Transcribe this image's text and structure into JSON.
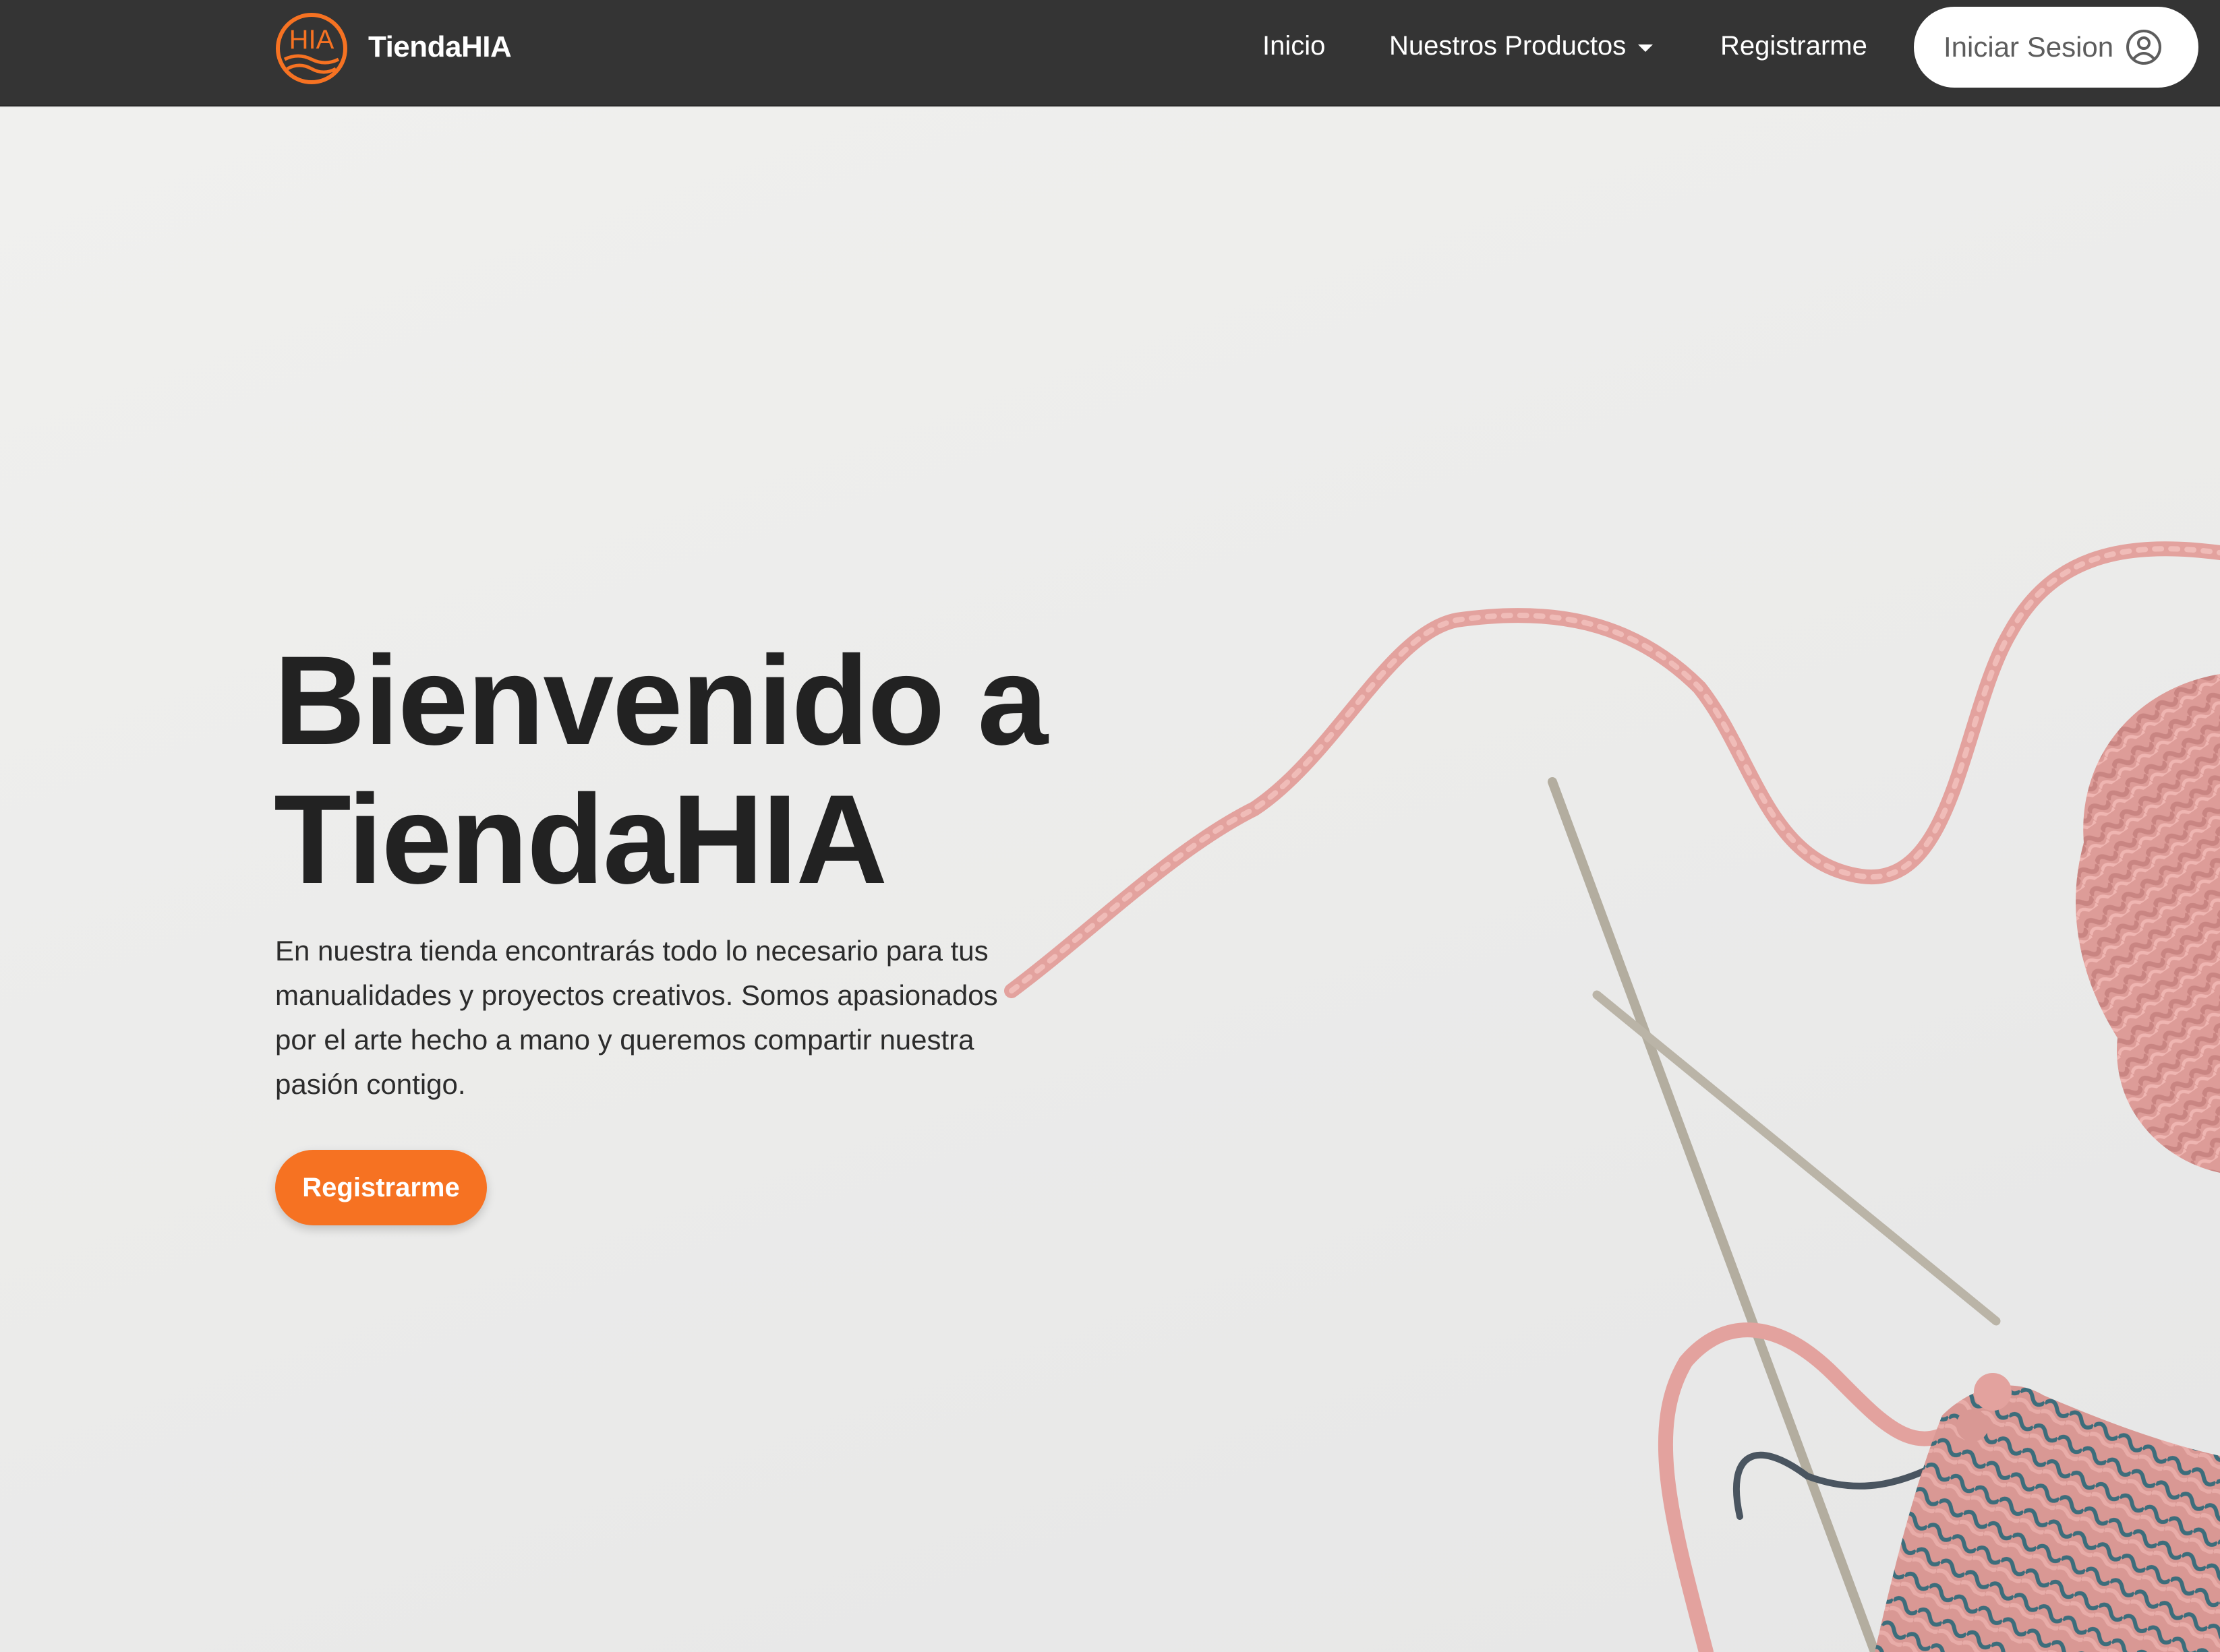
{
  "brand": {
    "logo_text": "HIA",
    "name": "TiendaHIA",
    "accent_color": "#f67222"
  },
  "nav": {
    "inicio": "Inicio",
    "productos": "Nuestros Productos",
    "registro": "Registrarme",
    "login": "Iniciar Sesion",
    "login_icon": "user-circle-icon",
    "dropdown_icon": "caret-down-icon",
    "background": "#343434"
  },
  "hero": {
    "title_line1": "Bienvenido a",
    "title_line2": "TiendaHIA",
    "text": "En nuestra tienda encontrarás todo lo necesario para tus manualidades y proyectos creativos. Somos apasionados por el arte hecho a mano y queremos compartir nuestra pasión contigo.",
    "cta": "Registrarme",
    "image": "knitting-yarn-and-needles",
    "yarn_color": "#e7a1a1"
  }
}
